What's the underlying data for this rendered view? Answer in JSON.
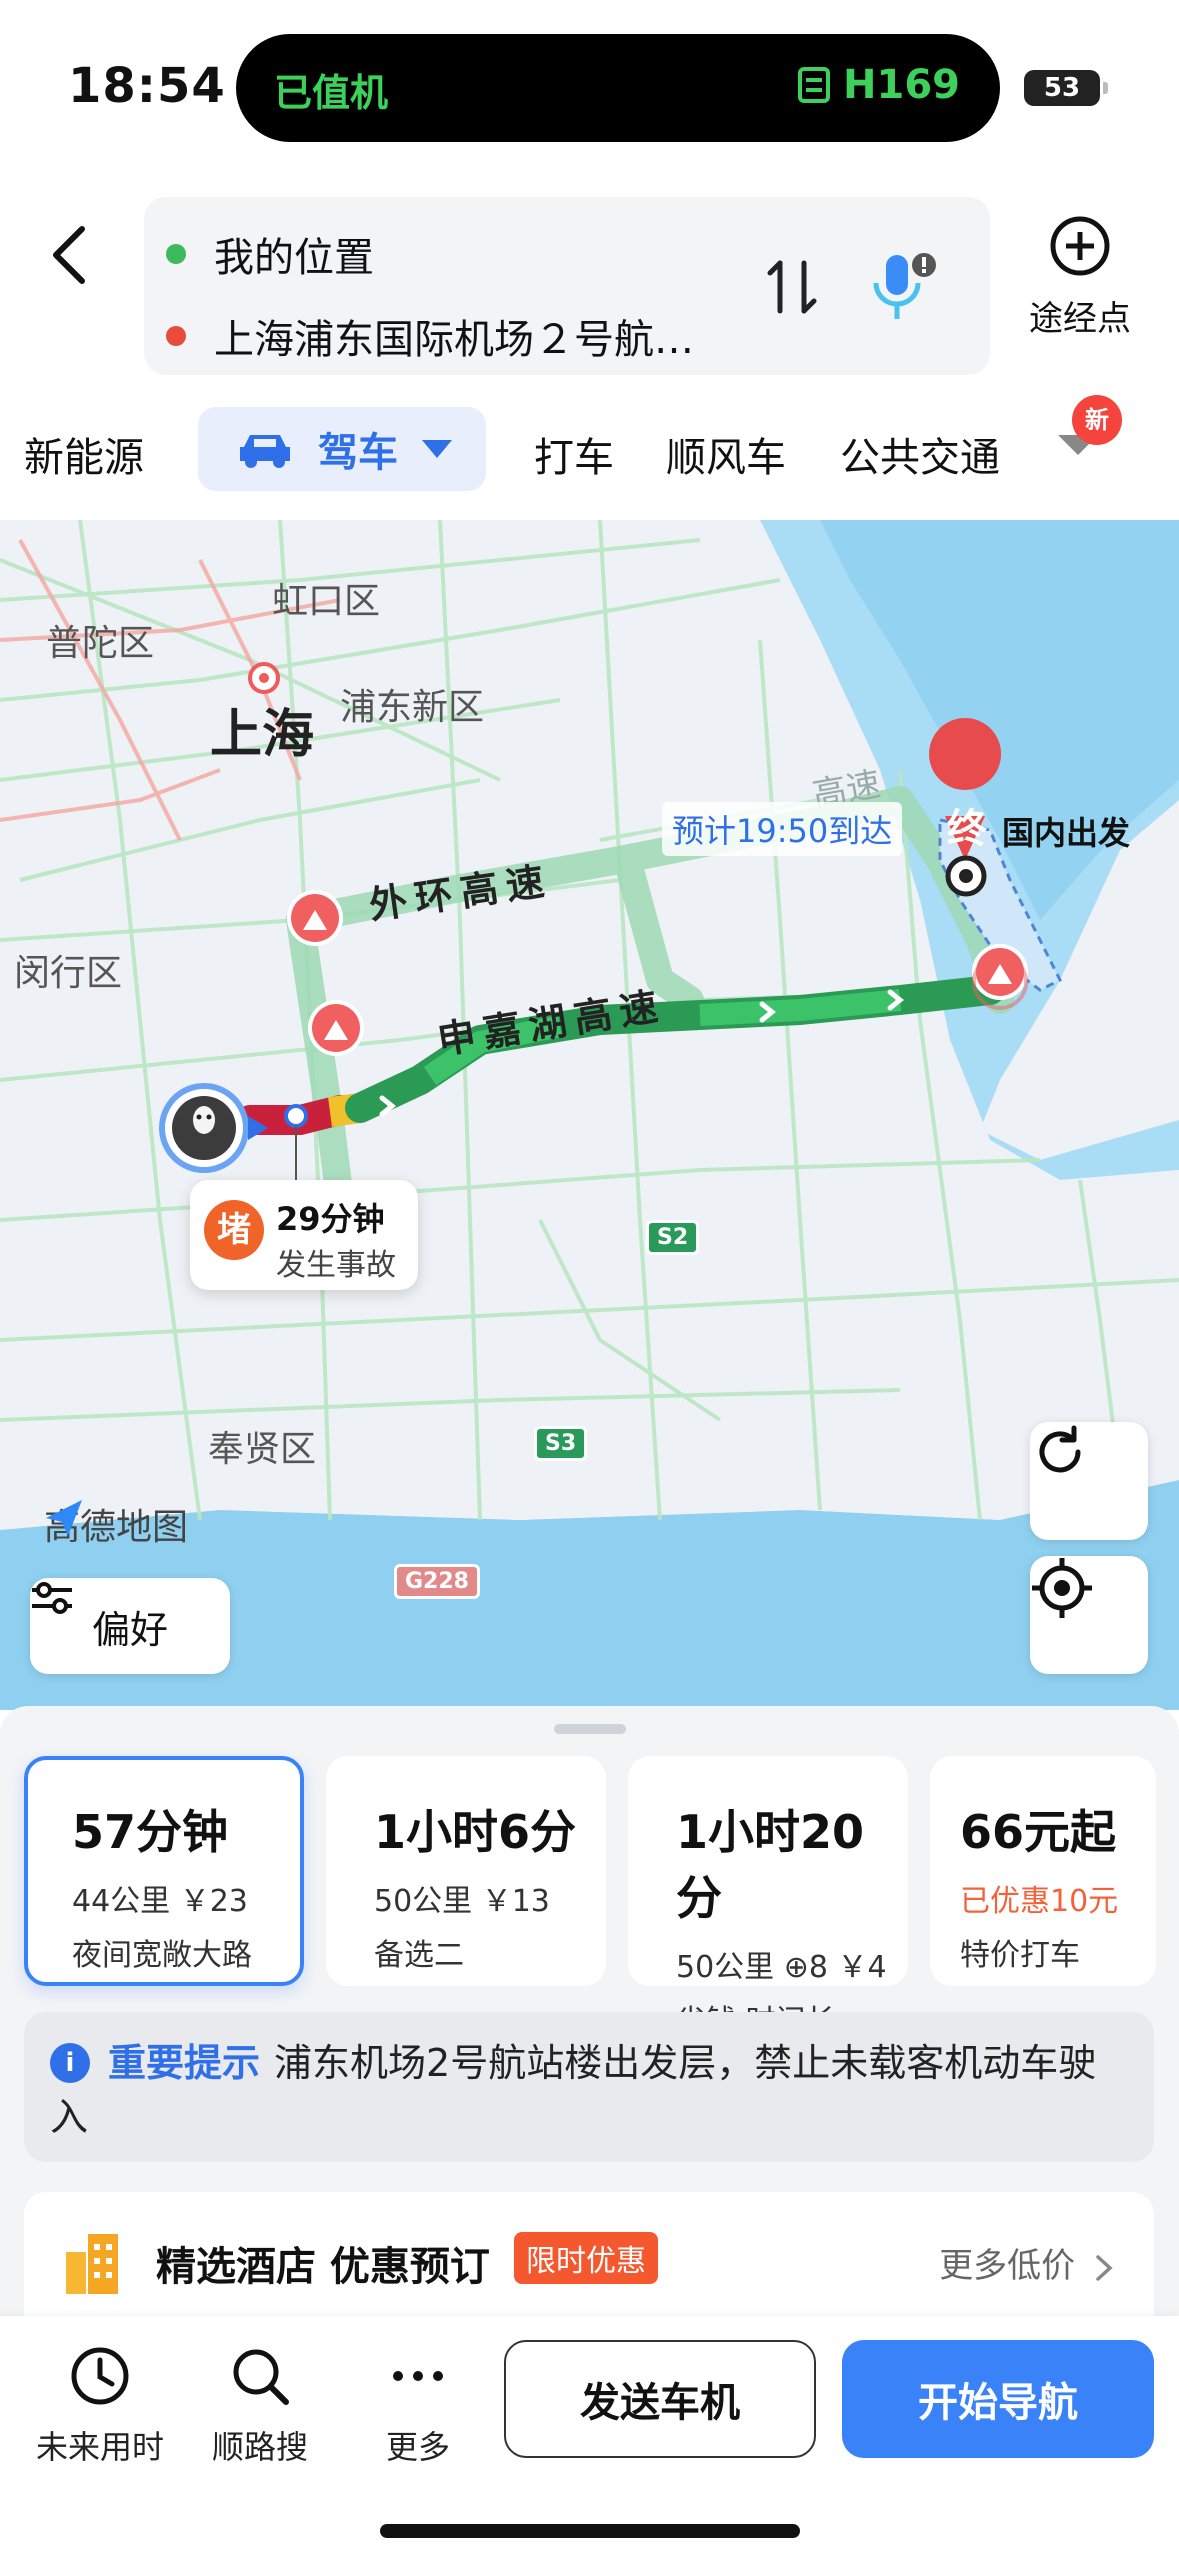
{
  "status_bar": {
    "time": "18:54",
    "island_left": "已值机",
    "island_right": "H169",
    "battery": "53"
  },
  "search": {
    "origin": "我的位置",
    "destination": "上海浦东国际机场２号航…",
    "waypoint_label": "途经点",
    "origin_color": "#3dbb5c",
    "destination_color": "#e84b3c"
  },
  "tabs": {
    "items": [
      "新能源",
      "驾车",
      "打车",
      "顺风车",
      "公共交通"
    ],
    "active": "驾车",
    "new_badge": "新"
  },
  "map": {
    "districts": [
      "虹口区",
      "普陀区",
      "浦东新区",
      "闵行区",
      "奉贤区"
    ],
    "city": "上海",
    "highways": [
      "外环高速",
      "申嘉湖高速"
    ],
    "faded_highway": "高速",
    "eta": "预计19:50到达",
    "destination_marker": "终",
    "destination_label": "国内出发",
    "jam_badge": "堵",
    "jam_time": "29分钟",
    "jam_desc": "发生事故",
    "shields": [
      "S2",
      "S3",
      "G228"
    ],
    "logo": "高德地图",
    "preference_button": "偏好"
  },
  "routes": [
    {
      "title": "57分钟",
      "line1": "44公里 ￥23",
      "line2": "夜间宽敞大路",
      "selected": true
    },
    {
      "title": "1小时6分",
      "line1": "50公里 ￥13",
      "line2": "备选二",
      "selected": false
    },
    {
      "title": "1小时20分",
      "line1": "50公里 ⊕8 ￥4",
      "line2": "省钱·时间长",
      "selected": false
    },
    {
      "title": "66元起",
      "discount": "已优惠10元",
      "line2": "特价打车",
      "selected": false
    }
  ],
  "notice": {
    "title": "重要提示",
    "text": "浦东机场2号航站楼出发层，禁止未载客机动车驶入"
  },
  "hotel": {
    "title": "精选酒店 优惠预订",
    "tag": "限时优惠",
    "more": "更多低价"
  },
  "bottom_bar": {
    "future_time": "未来用时",
    "along_search": "顺路搜",
    "more": "更多",
    "send_to_car": "发送车机",
    "start_nav": "开始导航"
  }
}
